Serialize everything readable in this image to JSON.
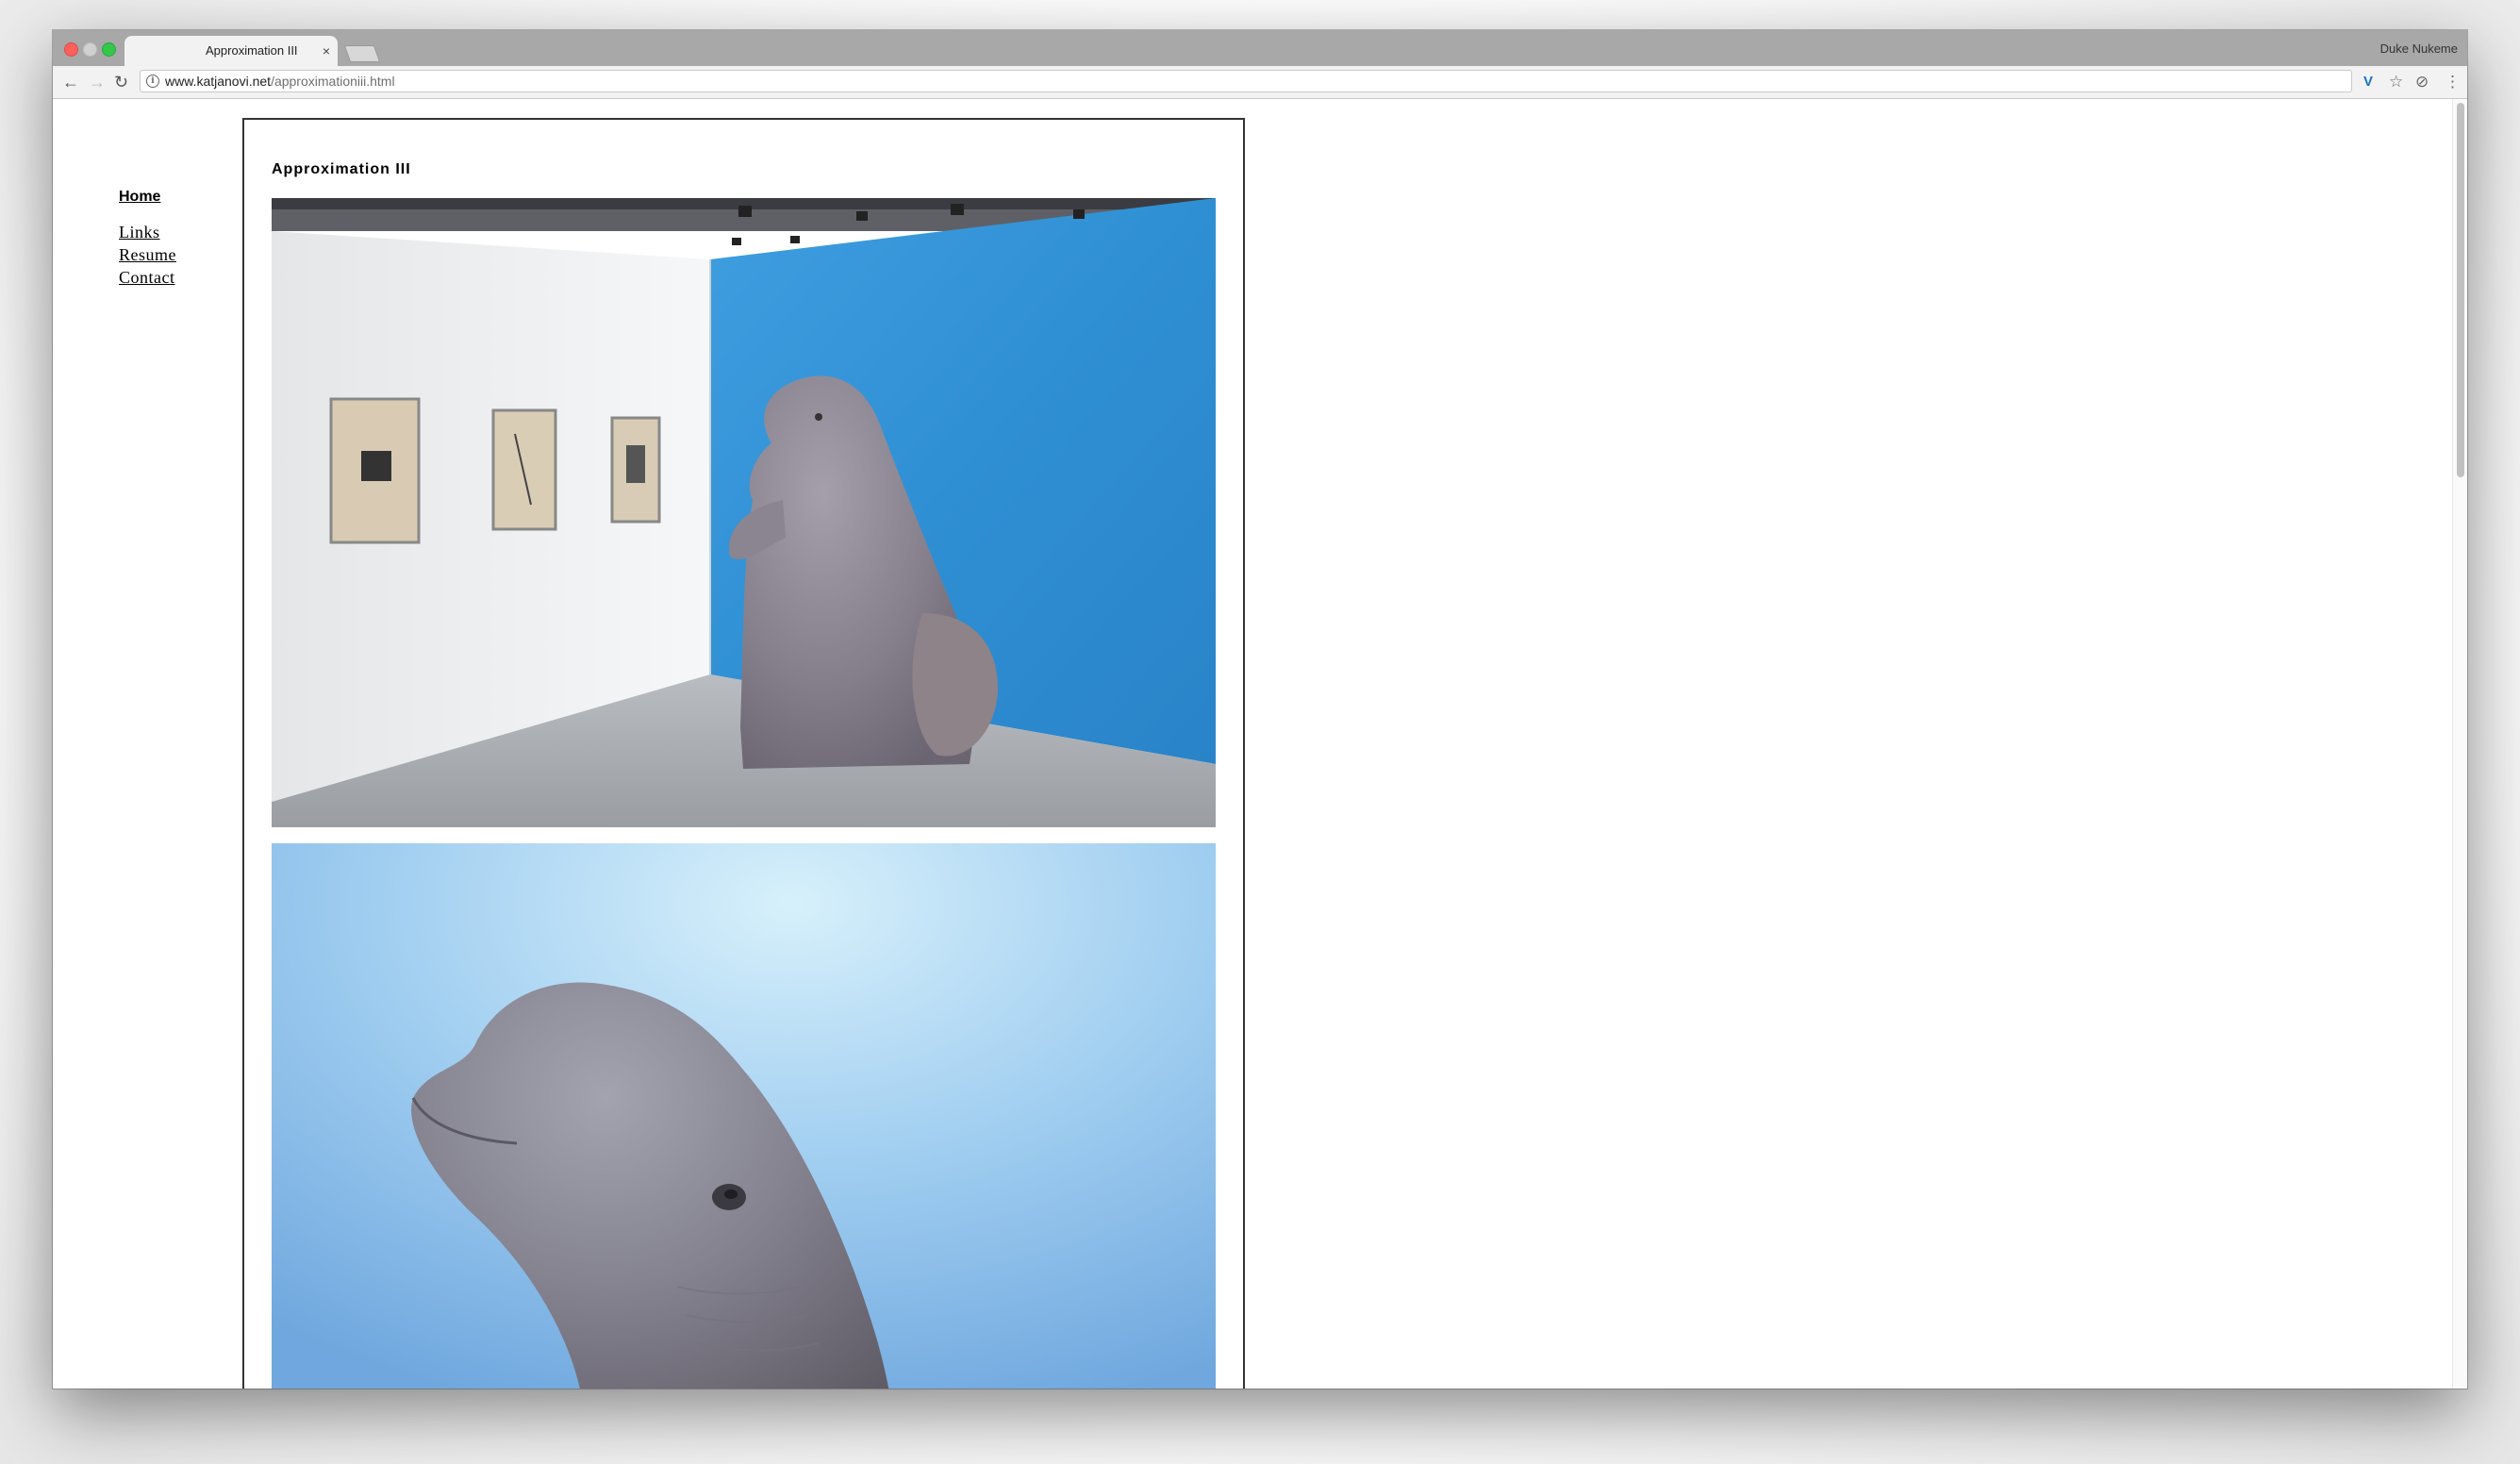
{
  "browser": {
    "tab_title": "Approximation III",
    "tab_close": "×",
    "profile_name": "Duke Nukeme",
    "url_host": "www.katjanovi.net",
    "url_path": "/approximationiii.html",
    "icons": {
      "back": "←",
      "forward": "→",
      "reload": "↻",
      "info": "i",
      "extension": "V",
      "bookmark": "☆",
      "extension2": "⊘",
      "menu": "⋮"
    }
  },
  "sidebar": {
    "home": "Home",
    "links": [
      {
        "label": "Links"
      },
      {
        "label": "Resume"
      },
      {
        "label": "Contact"
      }
    ]
  },
  "main": {
    "title": "Approximation III"
  },
  "colors": {
    "tabstrip": "#a8a8a8",
    "toolbar": "#f2f2f2",
    "gallery_blue": "#2f8fd3",
    "beluga_gray": "#7f7a86"
  }
}
